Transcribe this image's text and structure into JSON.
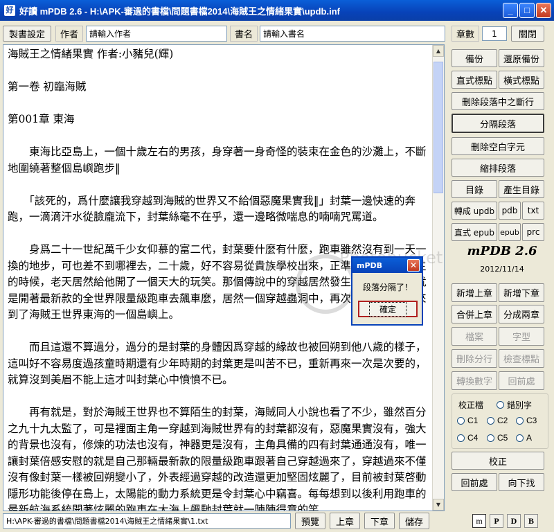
{
  "window": {
    "title": "好讀 mPDB 2.6 - H:\\APK-審過的書檔\\問題書檔2014\\海賊王之情緒果實\\updb.inf",
    "btn_min": "_",
    "btn_max": "□",
    "btn_close": "✕"
  },
  "toolbar": {
    "settings_label": "製書設定",
    "author_label": "作者",
    "author_value": "請輸入作者",
    "bookname_label": "書名",
    "bookname_value": "請輸入書名",
    "chapter_label": "章數",
    "chapter_value": "1",
    "close_label": "關閉"
  },
  "editor": {
    "lines": [
      "海賊王之情緒果實 作者:小豬兒(輝)",
      "",
      "第一卷 初臨海賊",
      "",
      "第001章 東海",
      "",
      "　　東海比亞島上，一個十歲左右的男孩，身穿著一身奇怪的裝束在金色的沙灘上，不斷地圍繞著整個島嶼跑步‖",
      "",
      "　　「該死的，爲什麼讓我穿越到海賊的世界又不給個惡魔果實我‖」封葉一邊快速的奔跑，一滴滴汗水從臉龐流下，封葉絲毫不在乎，還一邊略微喘息的喃喃咒罵道。",
      "",
      "　　身爲二十一世紀萬千少女仰慕的富二代，封葉要什麼有什麼，跑車雖然沒有到一天一換的地步，可也差不到哪裡去，二十歲，好不容易從貴族學校出來，正準備好好瀟灑人生的時候，老天居然給他開了一個天大的玩笑。那個傳說中的穿越居然發生在他身上，不就是開著最新款的全世界限量級跑車去飆車麼，居然一個穿越蟲洞中，再次醒來時就已經來到了海賊王世界東海的一個島嶼上。",
      "",
      "　　而且這還不算過分，過分的是封葉的身體因爲穿越的緣故也被回朔到他八歲的樣子，這叫好不容易度過孩童時期還有少年時期的封葉更是叫苦不已，重新再來一次是次要的，就算沒到美眉不能上這才叫封葉心中憤憤不已。",
      "",
      "　　再有就是，對於海賊王世界也不算陌生的封葉，海賊同人小說也看了不少，雖然百分之九十九太監了，可是裡面主角一穿越到海賊世界有的封葉都沒有，惡魔果實沒有，強大的背景也沒有，修煉的功法也沒有，神器更是沒有，主角具備的四有封葉通通沒有，唯一讓封葉倍感安慰的就是自己那輛最新款的限量級跑車跟著自己穿越過來了，穿越過來不僅沒有像封葉一樣被回朔變小了，外表經過穿越的改造還更加堅固炫麗了，目前被封葉啓動隱形功能後停在島上，太陽能的動力系統更是令封葉心中竊喜。每每想到以後利用跑車的最新航海系統開著炫麗的跑車在大海上飆馳封葉就一陣陣得意的笑。"
    ]
  },
  "dialog": {
    "title": "mPDB",
    "message": "段落分隔了！",
    "ok_label": "確定"
  },
  "side": {
    "backup": "備份",
    "restore": "還原備份",
    "vertical_mark": "直式標點",
    "horizontal_mark": "橫式標點",
    "remove_breaks": "刪除段落中之斷行",
    "split_paragraph": "分隔段落",
    "remove_whitespace": "刪除空白字元",
    "indent_paragraph": "縮排段落",
    "toc": "目錄",
    "gen_toc": "產生目錄",
    "convert_updb": "轉成 updb",
    "pdb": "pdb",
    "txt": "txt",
    "vertical_epub": "直式 epub",
    "epub": "epub",
    "prc": "prc",
    "brand": "mPDB 2.6",
    "date": "2012/11/14",
    "new_prev_chapter": "新增上章",
    "new_next_chapter": "新增下章",
    "merge_prev": "合併上章",
    "split_chapters": "分成兩章",
    "archive": "檔案",
    "font": "字型",
    "delete_line": "刪除分行",
    "check_marks": "檢查標點",
    "convert_number": "轉換數字",
    "go_back": "回前處",
    "proofread_file": "校正檔",
    "typo": "錯別字",
    "radio_c1": "C1",
    "radio_c2": "C2",
    "radio_c3": "C3",
    "radio_c4": "C4",
    "radio_c5": "C5",
    "radio_a": "A",
    "proofread": "校正",
    "go_back2": "回前處",
    "find_next": "向下找"
  },
  "status": {
    "path": "H:\\APK-審過的書檔\\問題書檔2014\\海賊王之情緒果實\\1.txt",
    "preview": "預覽",
    "prev_chapter": "上章",
    "next_chapter": "下章",
    "save": "儲存",
    "mode_m": "m",
    "mode_p": "P",
    "mode_d": "D",
    "mode_b": "B"
  }
}
